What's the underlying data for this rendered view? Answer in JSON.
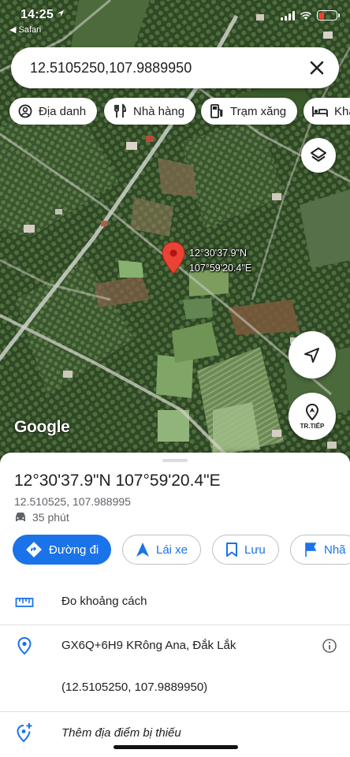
{
  "status_bar": {
    "time": "14:25",
    "back_app": "◀ Safari"
  },
  "search": {
    "value": "12.5105250,107.9889950"
  },
  "chips": [
    {
      "label": "Địa danh",
      "icon": "landmark-icon"
    },
    {
      "label": "Nhà hàng",
      "icon": "restaurant-icon"
    },
    {
      "label": "Trạm xăng",
      "icon": "gas-station-icon"
    },
    {
      "label": "Khá",
      "icon": "hotel-icon"
    }
  ],
  "map": {
    "pin_lat": "12°30'37.9\"N",
    "pin_lng": "107°59'20.4\"E",
    "logo": "Google",
    "next_label": "TR.TIẾP"
  },
  "place": {
    "title": "12°30'37.9\"N 107°59'20.4\"E",
    "decimal": "12.510525, 107.988995",
    "drive_time": "35 phút"
  },
  "actions": {
    "directions": "Đường đi",
    "start": "Lái xe",
    "save": "Lưu",
    "label": "Nhã"
  },
  "rows": {
    "measure": "Đo khoảng cách",
    "plus_code": "GX6Q+6H9 KRông Ana, Đắk Lắk",
    "coords": "(12.5105250, 107.9889950)",
    "add_place": "Thêm địa điểm bị thiếu"
  },
  "colors": {
    "primary": "#1a73e8",
    "pin": "#ea4335",
    "text": "#202124",
    "secondary_text": "#5f6368"
  }
}
